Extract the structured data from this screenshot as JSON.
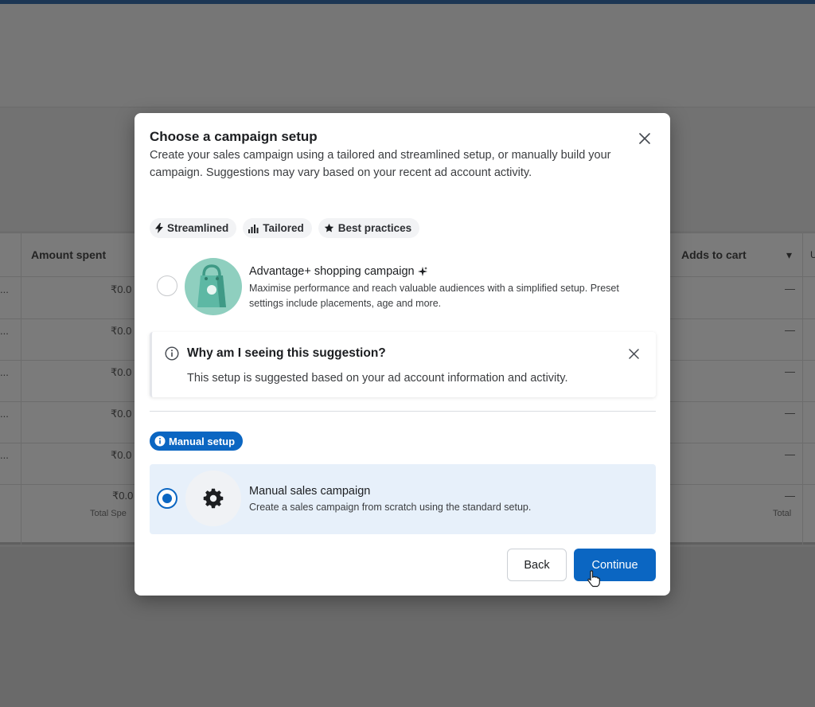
{
  "background": {
    "columns": {
      "amount_spent": "Amount spent",
      "adds_to_cart": "Adds to cart",
      "partial_col": "U"
    },
    "rows": [
      {
        "dots": "...",
        "amount": "₹0.0",
        "adds": "—"
      },
      {
        "dots": "...",
        "amount": "₹0.0",
        "adds": "—"
      },
      {
        "dots": "...",
        "amount": "₹0.0",
        "adds": "—"
      },
      {
        "dots": "...",
        "amount": "₹0.0",
        "adds": "—"
      },
      {
        "dots": "...",
        "amount": "₹0.0",
        "adds": "—"
      }
    ],
    "totals": {
      "amount": "₹0.0",
      "amount_label": "Total Spe",
      "adds": "—",
      "adds_label": "Total"
    }
  },
  "modal": {
    "title": "Choose a campaign setup",
    "description": "Create your sales campaign using a tailored and streamlined setup, or manually build your campaign. Suggestions may vary based on your recent ad account activity.",
    "chips": [
      {
        "icon": "bolt-icon",
        "label": "Streamlined"
      },
      {
        "icon": "bar-chart-icon",
        "label": "Tailored"
      },
      {
        "icon": "star-icon",
        "label": "Best practices"
      }
    ],
    "advantage_option": {
      "title": "Advantage+ shopping campaign",
      "description": "Maximise performance and reach valuable audiences with a simplified setup. Preset settings include placements, age and more.",
      "selected": false
    },
    "suggestion_note": {
      "title": "Why am I seeing this suggestion?",
      "body": "This setup is suggested based on your ad account information and activity."
    },
    "manual_badge": "Manual setup",
    "manual_option": {
      "title": "Manual sales campaign",
      "description": "Create a sales campaign from scratch using the standard setup.",
      "selected": true
    },
    "buttons": {
      "back": "Back",
      "continue": "Continue"
    }
  },
  "colors": {
    "primary": "#0b66c2",
    "selected_card": "#e7f0fa",
    "advantage_icon_bg": "#8fcfbf"
  }
}
